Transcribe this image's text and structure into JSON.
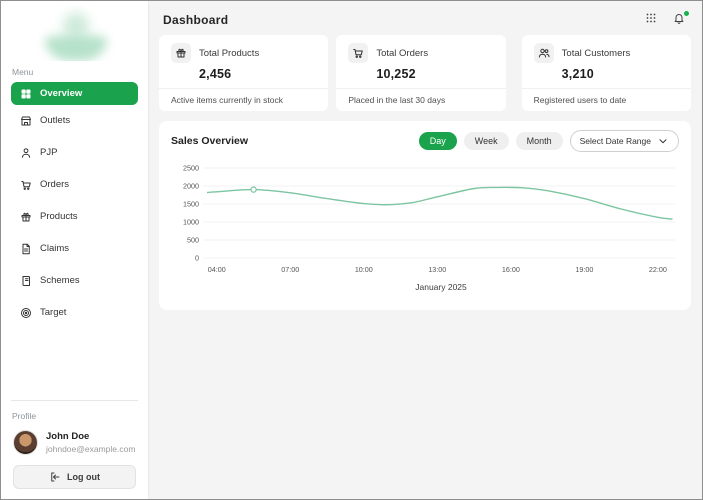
{
  "header": {
    "title": "Dashboard",
    "icons": [
      "apps-grid-icon",
      "bell-icon"
    ]
  },
  "sidebar": {
    "menu_label": "Menu",
    "items": [
      {
        "label": "Overview",
        "icon": "grid-icon",
        "active": true
      },
      {
        "label": "Outlets",
        "icon": "store-icon",
        "active": false
      },
      {
        "label": "PJP",
        "icon": "person-icon",
        "active": false
      },
      {
        "label": "Orders",
        "icon": "cart-icon",
        "active": false
      },
      {
        "label": "Products",
        "icon": "gift-icon",
        "active": false
      },
      {
        "label": "Claims",
        "icon": "file-icon",
        "active": false
      },
      {
        "label": "Schemes",
        "icon": "book-icon",
        "active": false
      },
      {
        "label": "Target",
        "icon": "target-icon",
        "active": false
      }
    ],
    "profile_label": "Profile",
    "user": {
      "name": "John Doe",
      "email": "johndoe@example.com"
    },
    "logout_label": "Log out"
  },
  "stats": [
    {
      "icon": "gift-icon",
      "label": "Total Products",
      "value": "2,456",
      "footer": "Active items currently in stock"
    },
    {
      "icon": "cart-icon",
      "label": "Total Orders",
      "value": "10,252",
      "footer": "Placed in the last 30 days"
    },
    {
      "icon": "users-icon",
      "label": "Total Customers",
      "value": "3,210",
      "footer": "Registered users to date"
    }
  ],
  "sales": {
    "title": "Sales Overview",
    "range_buttons": [
      {
        "label": "Day",
        "active": true
      },
      {
        "label": "Week",
        "active": false
      },
      {
        "label": "Month",
        "active": false
      }
    ],
    "date_range_label": "Select Date Range"
  },
  "chart_data": {
    "type": "line",
    "title": "Sales Overview",
    "xlabel": "January 2025",
    "x_unit": "hour_of_day",
    "x": [
      3.6,
      4,
      5.5,
      7,
      8.5,
      10,
      11,
      12,
      13,
      14.5,
      15.5,
      16.5,
      17.5,
      19,
      20.5,
      22,
      22.6
    ],
    "values": [
      1820,
      1840,
      1900,
      1810,
      1650,
      1510,
      1480,
      1540,
      1700,
      1930,
      1960,
      1950,
      1870,
      1650,
      1360,
      1130,
      1080
    ],
    "marker_point": {
      "x": 5.5,
      "y": 1900
    },
    "x_ticks": [
      {
        "hour": 4,
        "label": "04:00"
      },
      {
        "hour": 7,
        "label": "07:00"
      },
      {
        "hour": 10,
        "label": "10:00"
      },
      {
        "hour": 13,
        "label": "13:00"
      },
      {
        "hour": 16,
        "label": "16:00"
      },
      {
        "hour": 19,
        "label": "19:00"
      },
      {
        "hour": 22,
        "label": "22:00"
      }
    ],
    "y_ticks": [
      0,
      500,
      1000,
      1500,
      2000,
      2500
    ],
    "ylim": [
      0,
      2500
    ],
    "grid": "horizontal",
    "legend": "none",
    "line_color": "#7cc5a0"
  },
  "colors": {
    "primary_green": "#1aa34c",
    "line_green": "#7cc5a0",
    "notification_dot": "#19b14f",
    "background": "#f4f4f5",
    "card": "#ffffff"
  }
}
